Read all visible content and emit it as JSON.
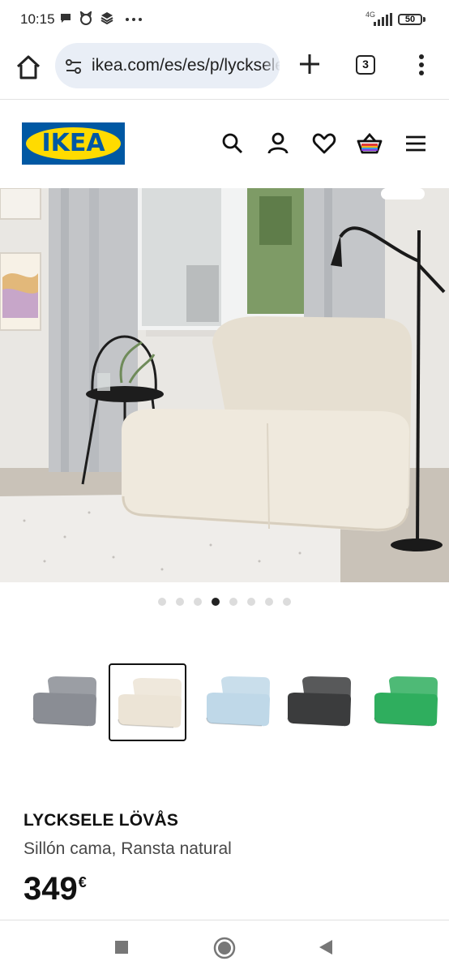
{
  "status_bar": {
    "time": "10:15",
    "network": "4G",
    "battery": "50",
    "icons": [
      "chat-icon",
      "cat-icon",
      "layers-icon",
      "more-dots-icon"
    ]
  },
  "browser": {
    "url": "ikea.com/es/es/p/lycksele-lovas",
    "tab_count": "3"
  },
  "header": {
    "logo_text": "IKEA",
    "icons": [
      "search-icon",
      "user-icon",
      "heart-icon",
      "basket-icon",
      "hamburger-menu-icon"
    ]
  },
  "carousel": {
    "total": 8,
    "active_index": 3
  },
  "swatches": [
    {
      "name": "gray",
      "color": "#8a8d94",
      "selected": false
    },
    {
      "name": "natural",
      "color": "#ece4d6",
      "selected": true
    },
    {
      "name": "blue-pattern",
      "color": "#bfd8e8",
      "selected": false
    },
    {
      "name": "dark-gray",
      "color": "#3b3c3d",
      "selected": false
    },
    {
      "name": "green",
      "color": "#2fae5e",
      "selected": false
    }
  ],
  "product": {
    "name": "LYCKSELE LÖVÅS",
    "description": "Sillón cama, Ransta natural",
    "price": "349",
    "currency": "€"
  },
  "colors": {
    "ikea_blue": "#0058a3",
    "ikea_yellow": "#ffdb00",
    "url_bg": "#e9eef6"
  }
}
